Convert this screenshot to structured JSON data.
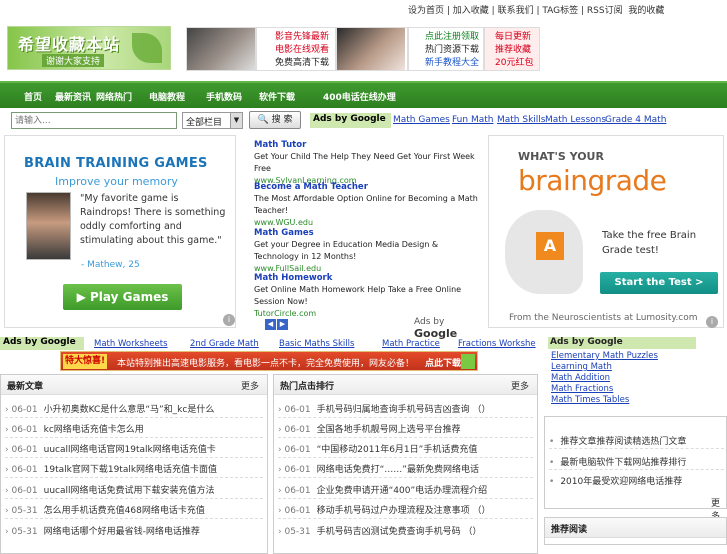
{
  "topbar": {
    "links": [
      "设为首页",
      "加入收藏",
      "联系我们",
      "TAG标签",
      "RSS订阅",
      "我的收藏"
    ]
  },
  "logo": {
    "title": "希望收藏本站",
    "subtitle": "谢谢大家支持"
  },
  "banner": {
    "b1_lines": [
      "影音先锋最新",
      "电影在线观看",
      "免费高清下载"
    ],
    "b2_lines": [
      "点此注册领取",
      "热门资源下载",
      "新手教程大全"
    ],
    "b3_lines": [
      "每日更新",
      "推荐收藏",
      "20元红包"
    ]
  },
  "nav": {
    "items": [
      "首页",
      "最新资讯",
      "网络热门",
      "电脑教程",
      "手机数码",
      "软件下载",
      "400电话在线办理"
    ]
  },
  "search": {
    "placeholder": "请输入...",
    "select_value": "全部栏目",
    "button_label": "搜 索"
  },
  "adbar": {
    "ads_label": "Ads by Google",
    "links": [
      "Math Games",
      "Fun Math",
      "Math Skills",
      "Math Lessons",
      "Grade 4 Math"
    ]
  },
  "brain_ad": {
    "title": "BRAIN TRAINING GAMES",
    "subtitle": "Improve your memory",
    "quote": "\"My favorite game is Raindrops! There is something oddly comforting and stimulating about this game.\"",
    "author": "- Mathew, 25",
    "button": "Play Games"
  },
  "text_ads": {
    "items": [
      {
        "title": "Math Tutor",
        "desc": "Get Your Child The Help They Need Get Your First Week Free",
        "url": "www.SylvanLearning.com"
      },
      {
        "title": "Become a Math Teacher",
        "desc": "The Most Affordable Option Online for Becoming a Math Teacher!",
        "url": "www.WGU.edu"
      },
      {
        "title": "Math Games",
        "desc": "Get your Degree in Education Media Design & Technology in 12 Months!",
        "url": "www.FullSail.edu"
      },
      {
        "title": "Math Homework",
        "desc": "Get Online Math Homework Help Take a Free Online Session Now!",
        "url": "TutorCircle.com"
      }
    ],
    "ads_by": "Ads by",
    "google": "Google"
  },
  "lumosity": {
    "what": "WHAT'S YOUR",
    "brain": "braingrade",
    "letter": "A",
    "take": "Take the free Brain Grade test!",
    "button": "Start the Test >",
    "from": "From the Neuroscientists at Lumosity.com"
  },
  "linkrow": {
    "ads_label": "Ads by Google",
    "links": [
      "Math Worksheets",
      "2nd Grade Math",
      "Basic Maths Skills",
      "Math Practice",
      "Fractions Workshe"
    ]
  },
  "promo": {
    "tag": "特大惊喜!",
    "text": "本站特别推出高速电影服务，看电影一点不卡，完全免费使用，网友必备！",
    "download": "点此下载"
  },
  "right_ads": {
    "label": "Ads by Google",
    "links": [
      "Elementary Math Puzzles",
      "Learning Math",
      "Math Addition",
      "Math Fractions",
      "Math Times Tables"
    ]
  },
  "box1": {
    "title": "最新文章",
    "more": "更多",
    "rows": [
      {
        "date": "06-01",
        "text": "小升初奥数KC是什么意思“马”和_kc是什么"
      },
      {
        "date": "06-01",
        "text": "kc网络电话充值卡怎么用"
      },
      {
        "date": "06-01",
        "text": "uucall网络电话官网19talk网络电话充值卡"
      },
      {
        "date": "06-01",
        "text": "19talk官网下载19talk网络电话充值卡面值"
      },
      {
        "date": "06-01",
        "text": "uucall网络电话免费试用下载安装充值方法"
      },
      {
        "date": "05-31",
        "text": "怎么用手机话费充值468网络电话卡充值"
      },
      {
        "date": "05-31",
        "text": "网络电话哪个好用最省钱-网络电话推荐"
      }
    ]
  },
  "box2": {
    "title": "热门点击排行",
    "more": "更多",
    "rows": [
      {
        "date": "06-01",
        "text": "手机号码归属地查询手机号码吉凶查询 （）"
      },
      {
        "date": "06-01",
        "text": "全国各地手机靓号网上选号平台推荐"
      },
      {
        "date": "06-01",
        "text": "“中国移动2011年6月1日”手机话费充值"
      },
      {
        "date": "06-01",
        "text": "网络电话免费打“……”最新免费网络电话"
      },
      {
        "date": "06-01",
        "text": "企业免费申请开通“400”电话办理流程介绍"
      },
      {
        "date": "06-01",
        "text": "移动手机号码过户办理流程及注意事项 （）"
      },
      {
        "date": "05-31",
        "text": "手机号码吉凶测试免费查询手机号码 （）"
      }
    ]
  },
  "box3": {
    "more": "更多",
    "rows": [
      "推荐文章推荐阅读精选热门文章",
      "最新电脑软件下载网站推荐排行",
      "2010年最受欢迎网络电话推荐"
    ]
  },
  "box4": {
    "title": "推荐阅读"
  }
}
